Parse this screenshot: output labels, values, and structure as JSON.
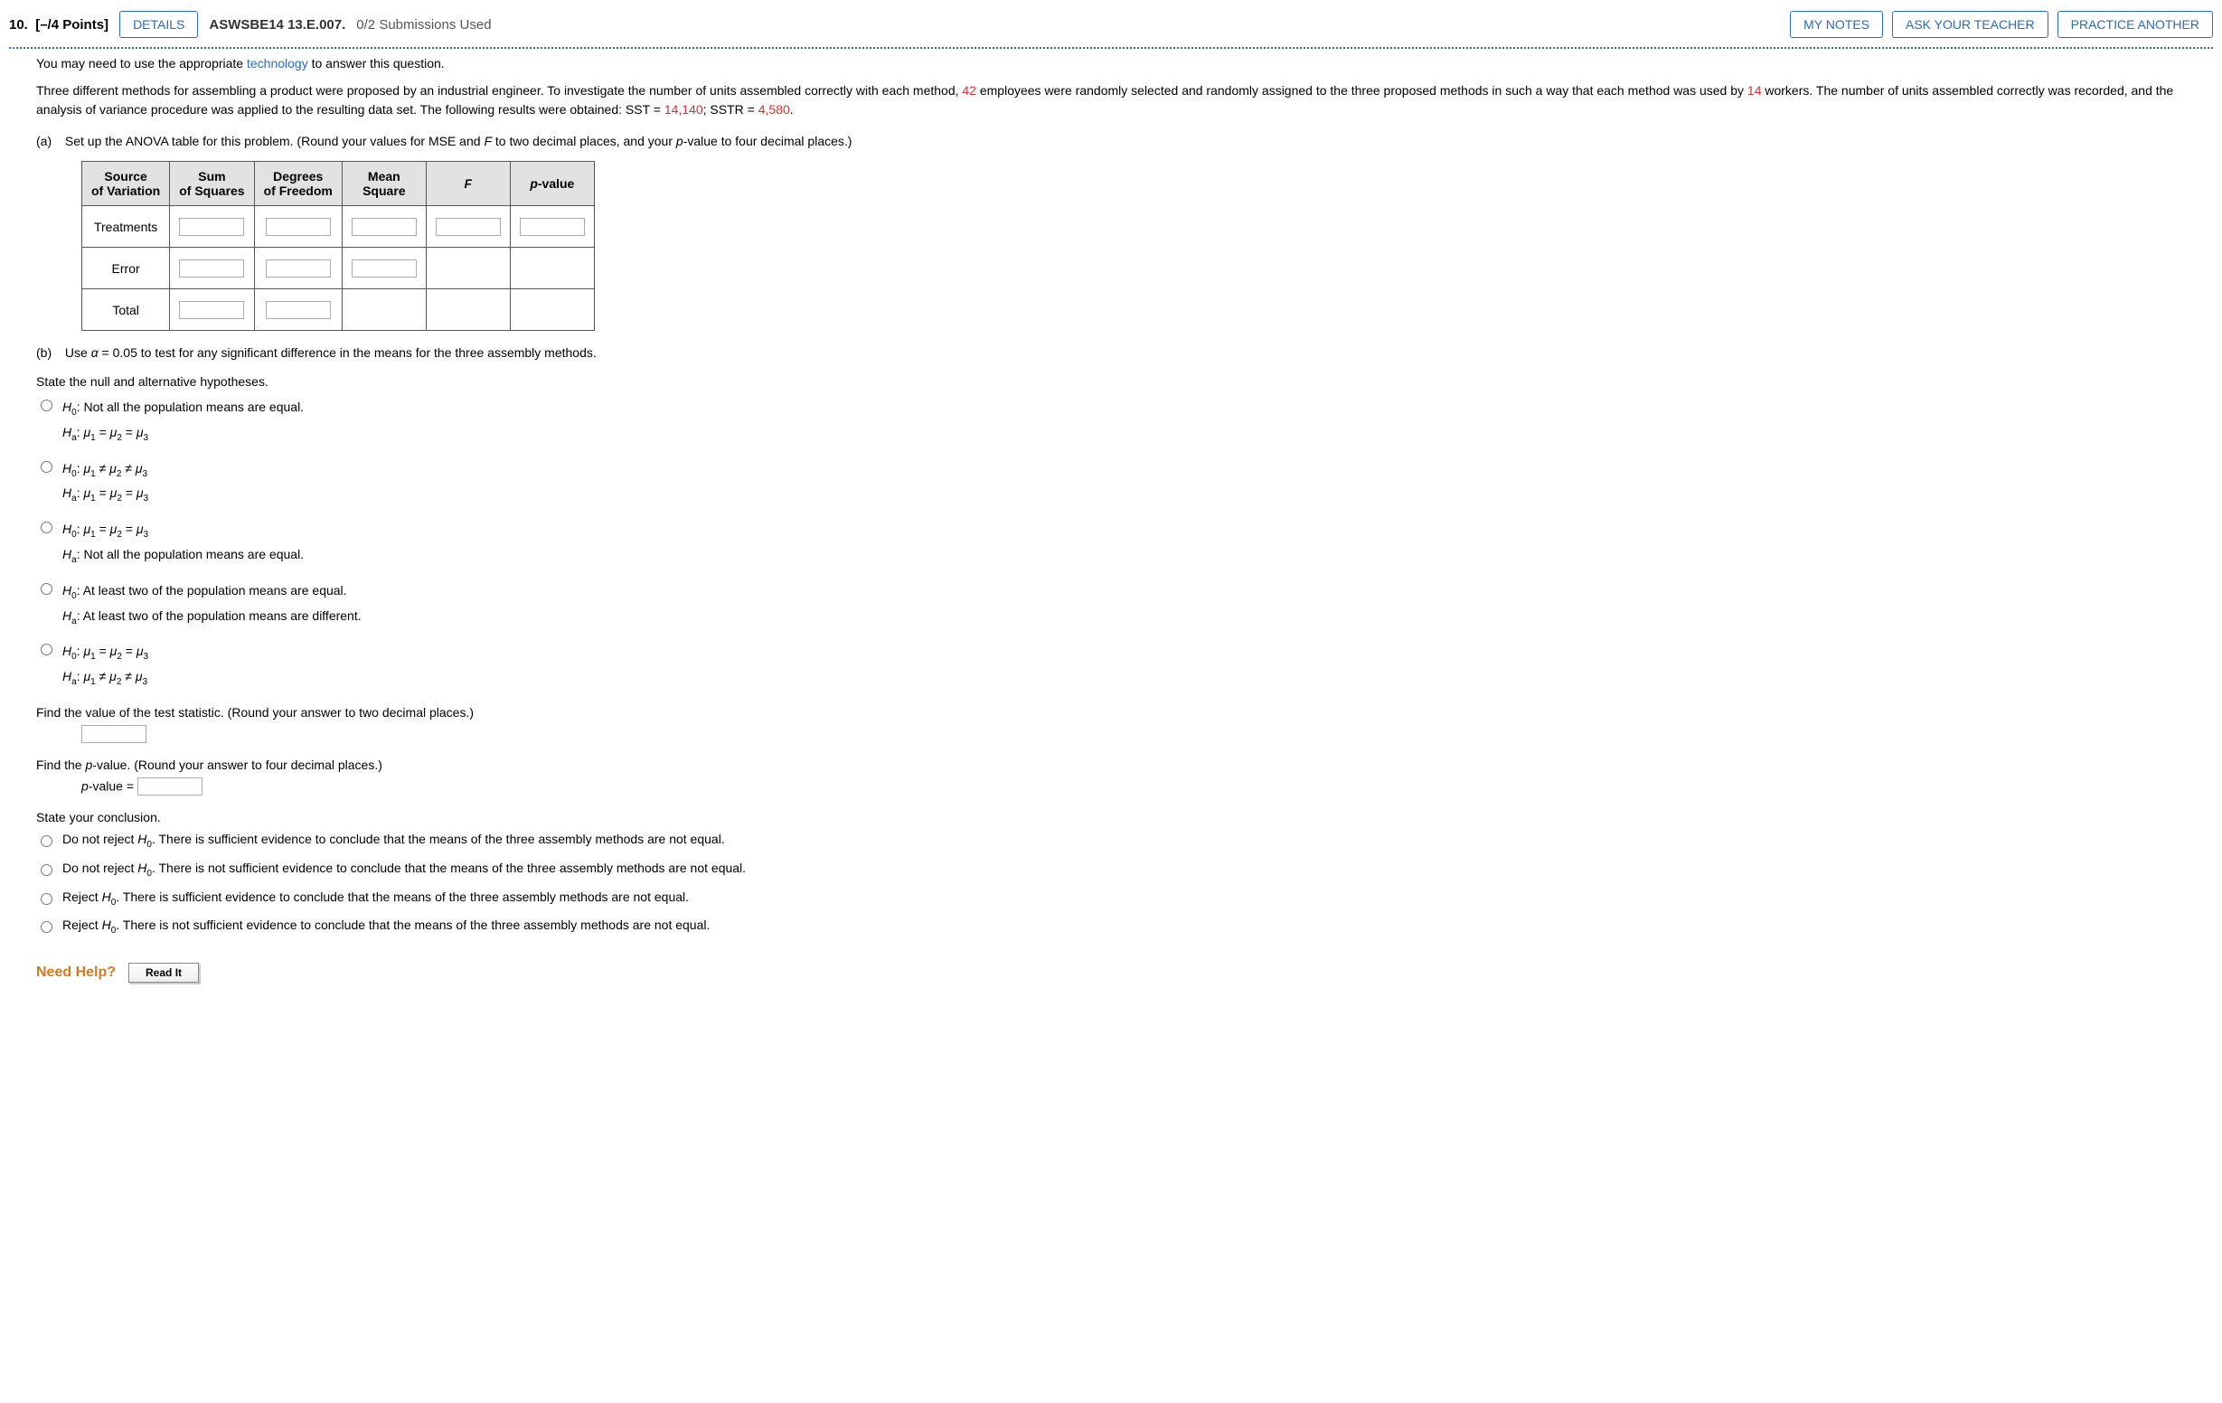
{
  "header": {
    "question_number": "10.",
    "points": "[–/4 Points]",
    "details_btn": "DETAILS",
    "assignment_code": "ASWSBE14 13.E.007.",
    "submissions": "0/2 Submissions Used",
    "my_notes_btn": "MY NOTES",
    "ask_teacher_btn": "ASK YOUR TEACHER",
    "practice_btn": "PRACTICE ANOTHER"
  },
  "notice": {
    "prefix": "You may need to use the appropriate ",
    "tech_link": "technology",
    "suffix": " to answer this question."
  },
  "problem": {
    "p1a": "Three different methods for assembling a product were proposed by an industrial engineer. To investigate the number of units assembled correctly with each method, ",
    "v1": "42",
    "p1b": " employees were randomly selected and randomly assigned to the three proposed methods in such a way that each method was used by ",
    "v2": "14",
    "p1c": " workers. The number of units assembled correctly was recorded, and the analysis of variance procedure was applied to the resulting data set. The following results were obtained: SST = ",
    "v3": "14,140",
    "p1d": "; SSTR = ",
    "v4": "4,580",
    "p1e": "."
  },
  "partA": {
    "letter": "(a)",
    "instr_a": "Set up the ANOVA table for this problem. (Round your values for MSE and ",
    "instr_b": " to two decimal places, and your ",
    "instr_c": "-value to four decimal places.)",
    "f_sym": "F",
    "p_sym": "p",
    "table": {
      "h1": "Source\nof Variation",
      "h2": "Sum\nof Squares",
      "h3": "Degrees\nof Freedom",
      "h4": "Mean\nSquare",
      "h5": "F",
      "h6": "p-value",
      "r1": "Treatments",
      "r2": "Error",
      "r3": "Total"
    }
  },
  "partB": {
    "letter": "(b)",
    "instr_a": "Use ",
    "alpha_sym": "α",
    "alpha_eq": " = 0.05 to test for any significant difference in the means for the three assembly methods.",
    "state_hyp": "State the null and alternative hypotheses.",
    "opt1": {
      "l1": "H₀: Not all the population means are equal.",
      "l2": "Hₐ: μ₁ = μ₂ = μ₃"
    },
    "opt2": {
      "l1": "H₀: μ₁ ≠ μ₂ ≠ μ₃",
      "l2": "Hₐ: μ₁ = μ₂ = μ₃"
    },
    "opt3": {
      "l1": "H₀: μ₁ = μ₂ = μ₃",
      "l2": "Hₐ: Not all the population means are equal."
    },
    "opt4": {
      "l1": "H₀: At least two of the population means are equal.",
      "l2": "Hₐ: At least two of the population means are different."
    },
    "opt5": {
      "l1": "H₀: μ₁ = μ₂ = μ₃",
      "l2": "Hₐ: μ₁ ≠ μ₂ ≠ μ₃"
    },
    "test_stat_prompt": "Find the value of the test statistic. (Round your answer to two decimal places.)",
    "pvalue_prompt": "Find the p-value. (Round your answer to four decimal places.)",
    "pvalue_label": "p-value = ",
    "conclusion_prompt": "State your conclusion.",
    "conc1": "Do not reject H₀. There is sufficient evidence to conclude that the means of the three assembly methods are not equal.",
    "conc2": "Do not reject H₀. There is not sufficient evidence to conclude that the means of the three assembly methods are not equal.",
    "conc3": "Reject H₀. There is sufficient evidence to conclude that the means of the three assembly methods are not equal.",
    "conc4": "Reject H₀. There is not sufficient evidence to conclude that the means of the three assembly methods are not equal."
  },
  "help": {
    "label": "Need Help?",
    "read_it": "Read It"
  }
}
